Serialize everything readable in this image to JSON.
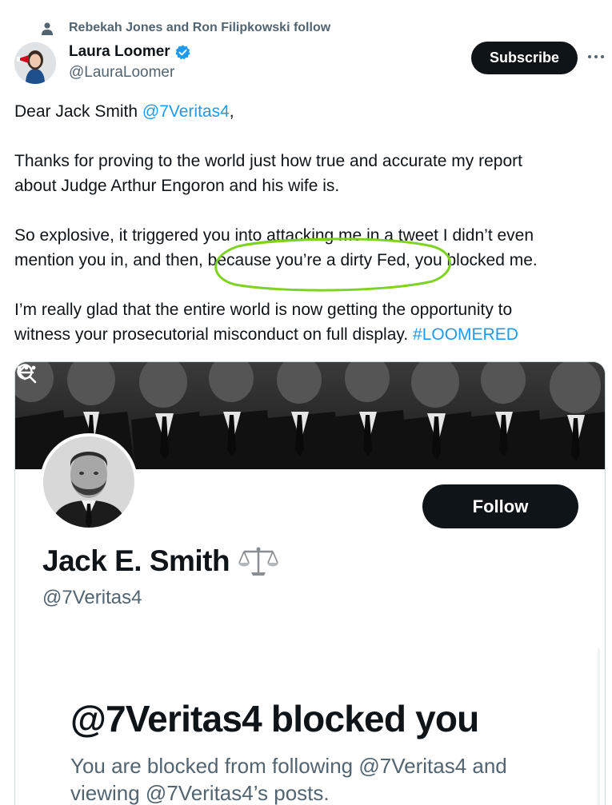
{
  "social_context": {
    "icon": "person-icon",
    "text": "Rebekah Jones and Ron Filipkowski follow"
  },
  "author": {
    "name": "Laura Loomer",
    "verified": true,
    "handle": "@LauraLoomer",
    "avatar": "avatar"
  },
  "actions": {
    "subscribe_label": "Subscribe",
    "more_icon": "more-horizontal-icon"
  },
  "tweet": {
    "p1": {
      "text": "Dear Jack Smith ",
      "mention": "@7Veritas4",
      "tail": ","
    },
    "p2": {
      "line1": "Thanks for proving to the world just how true and accurate my report",
      "line2": "about Judge Arthur Engoron and his wife is."
    },
    "p3": {
      "line1": "So explosive, it triggered you into attacking me in a tweet I didn’t even",
      "line2": "mention you in, and then, because you’re a dirty Fed, you blocked me."
    },
    "p4": {
      "line1": "I’m really glad that the entire world is now getting the opportunity to",
      "line2_text": "witness your prosecutorial misconduct on full display. ",
      "hashtag": "#LOOMERED"
    },
    "annotation_color": "#7ed321"
  },
  "embedded_screenshot": {
    "back_icon": "back-arrow-icon",
    "search_icon": "search-icon",
    "more_icon": "more-horizontal-icon",
    "follow_label": "Follow",
    "profile_name": "Jack E. Smith",
    "profile_emoji": "scales-icon",
    "profile_handle": "@7Veritas4",
    "blocked_title": "@7Veritas4 blocked you",
    "blocked_desc_line1": "You are blocked from following @7Veritas4 and",
    "blocked_desc_line2": "viewing @7Veritas4’s posts."
  },
  "colors": {
    "text": "#0f1419",
    "secondary": "#536471",
    "link": "#1d9bf0",
    "button": "#0f1419",
    "border": "#cfd9de"
  }
}
